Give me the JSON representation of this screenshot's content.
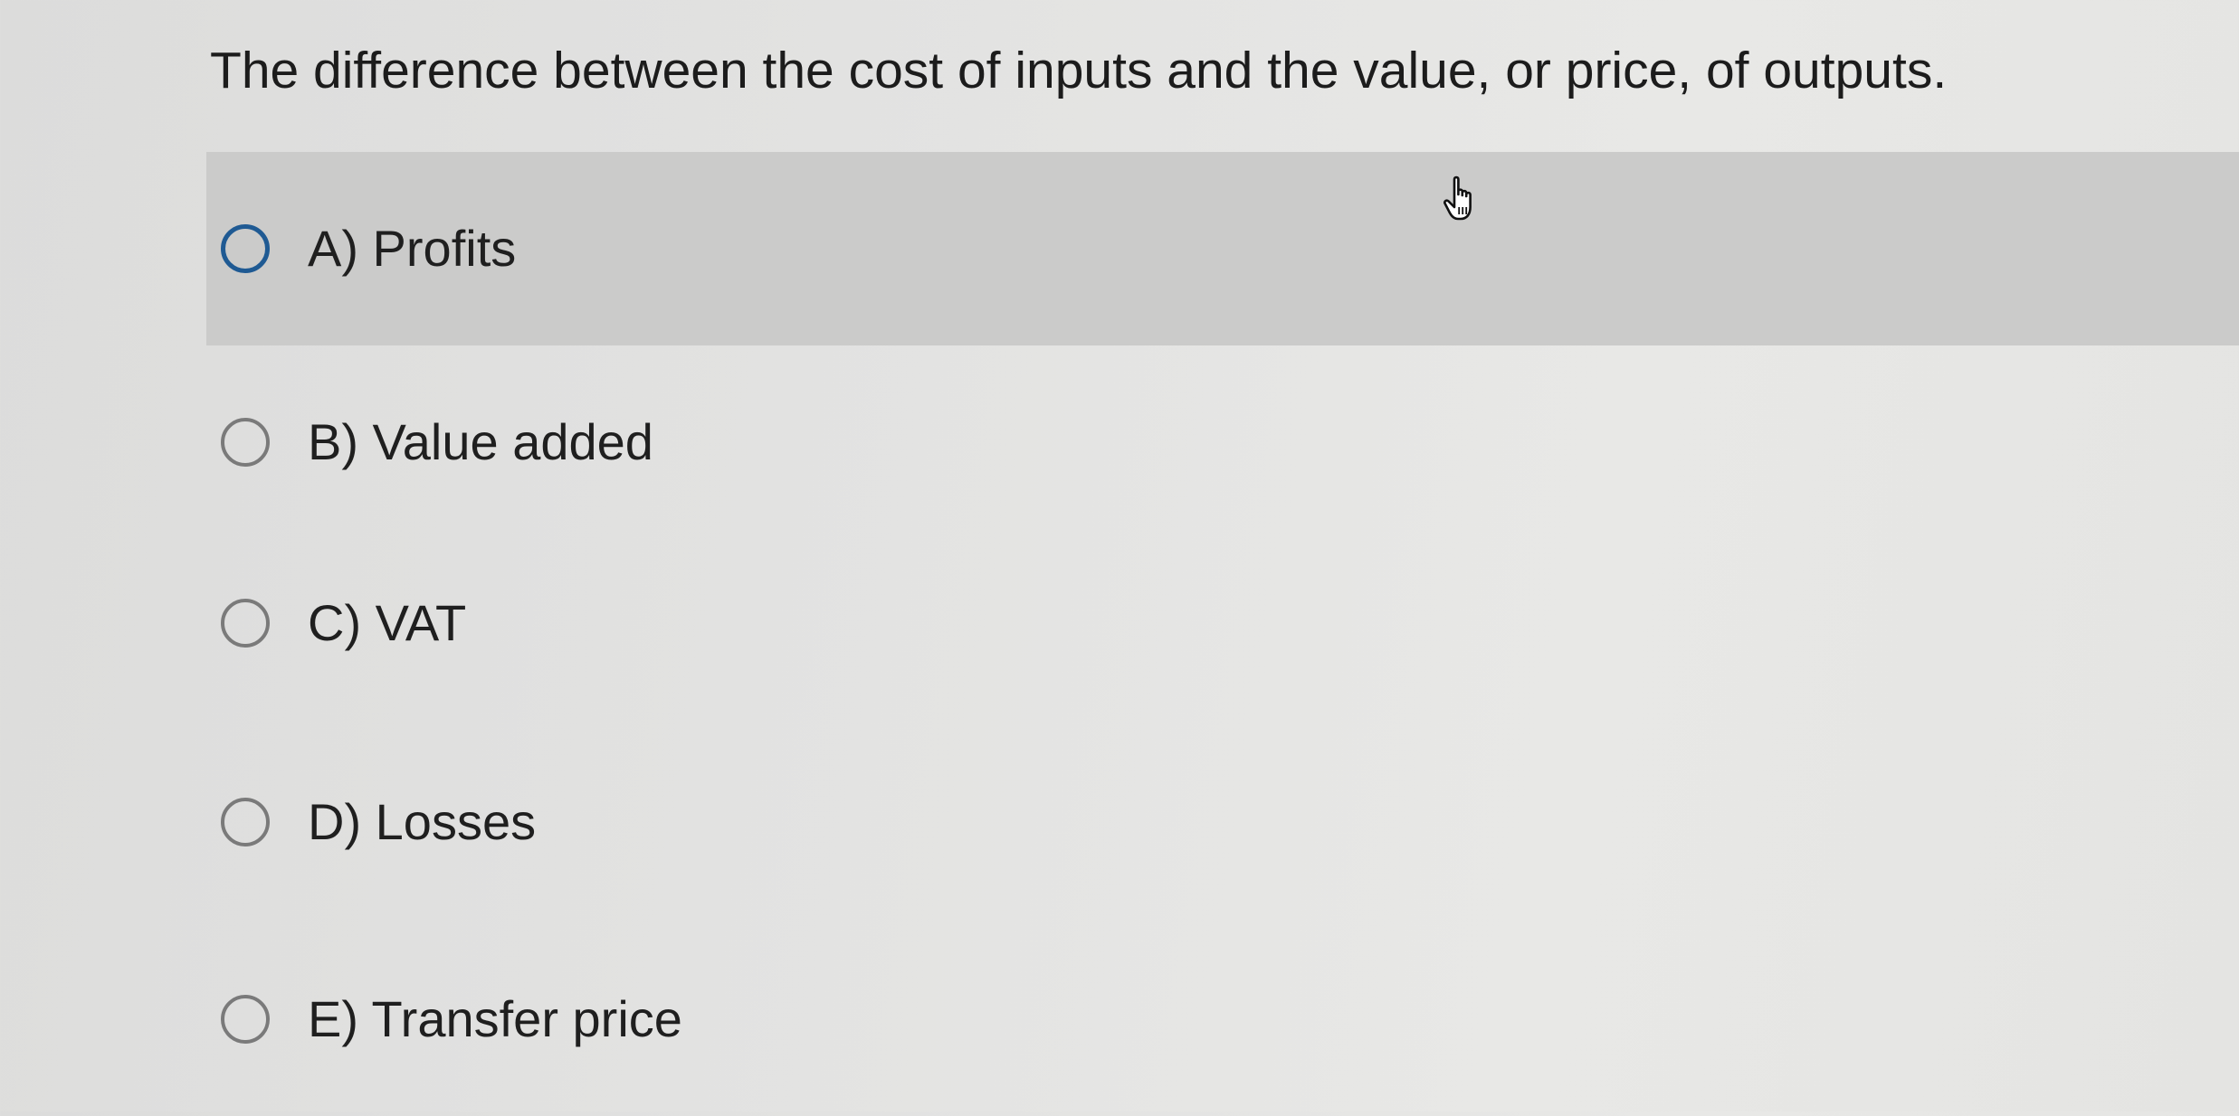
{
  "question": {
    "text": "The difference between the cost of inputs and the value, or price, of outputs."
  },
  "options": [
    {
      "letter": "A",
      "label": "A)  Profits",
      "hovered": true,
      "selected": false
    },
    {
      "letter": "B",
      "label": "B)  Value added",
      "hovered": false,
      "selected": false
    },
    {
      "letter": "C",
      "label": "C)  VAT",
      "hovered": false,
      "selected": false
    },
    {
      "letter": "D",
      "label": "D)  Losses",
      "hovered": false,
      "selected": false
    },
    {
      "letter": "E",
      "label": "E)  Transfer price",
      "hovered": false,
      "selected": false
    }
  ],
  "colors": {
    "hover_background": "#cbcbca",
    "hover_radio_border": "#1f5a93",
    "radio_border": "#7a7a7a",
    "text": "#1f1f1f"
  },
  "icons": {
    "cursor": "hand-pointer-icon"
  }
}
